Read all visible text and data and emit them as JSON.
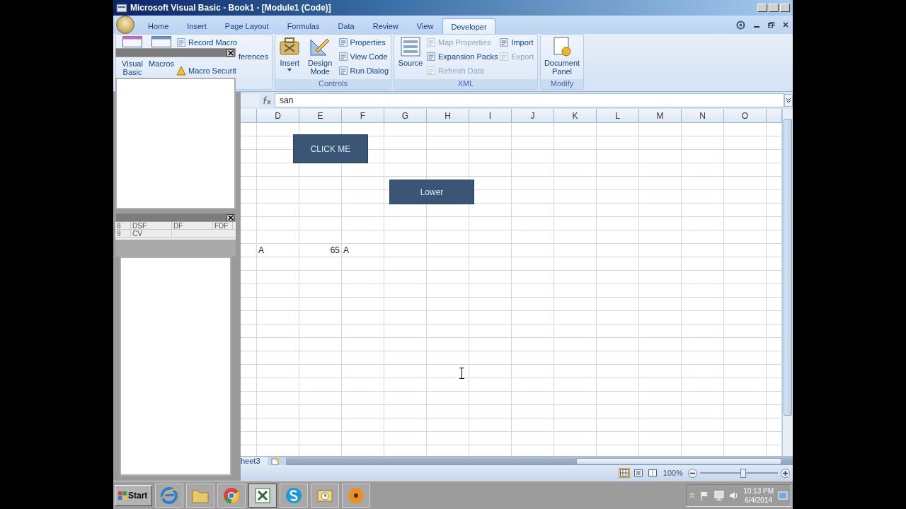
{
  "window": {
    "title": "Microsoft Visual Basic - Book1 - [Module1 (Code)]"
  },
  "tabs": [
    {
      "label": "Home",
      "selected": false
    },
    {
      "label": "Insert",
      "selected": false
    },
    {
      "label": "Page Layout",
      "selected": false
    },
    {
      "label": "Formulas",
      "selected": false
    },
    {
      "label": "Data",
      "selected": false
    },
    {
      "label": "Review",
      "selected": false
    },
    {
      "label": "View",
      "selected": false
    },
    {
      "label": "Developer",
      "selected": true
    }
  ],
  "code_group": {
    "large_buttons": [
      "Visual Basic",
      "Macros"
    ],
    "small_buttons": [
      {
        "label": "Record Macro",
        "kind": "full"
      },
      {
        "label": "ferences",
        "kind": "covered"
      },
      {
        "label": "Macro Securit",
        "kind": "full"
      }
    ]
  },
  "groups": [
    {
      "label": "Controls",
      "items": [
        {
          "label": "Insert",
          "kind": "large",
          "dropdown": true,
          "disabled": false
        },
        {
          "label": "Design Mode",
          "kind": "large",
          "dropdown": false,
          "disabled": false
        },
        {
          "label": "Properties",
          "kind": "small",
          "dropdown": false,
          "disabled": false
        },
        {
          "label": "View Code",
          "kind": "small",
          "dropdown": false,
          "disabled": false
        },
        {
          "label": "Run Dialog",
          "kind": "small",
          "dropdown": false,
          "disabled": false
        }
      ]
    },
    {
      "label": "XML",
      "items": [
        {
          "label": "Source",
          "kind": "large",
          "dropdown": false,
          "disabled": false
        },
        {
          "label": "Map Properties",
          "kind": "small",
          "dropdown": false,
          "disabled": true
        },
        {
          "label": "Expansion Packs",
          "kind": "small",
          "dropdown": false,
          "disabled": false
        },
        {
          "label": "Refresh Data",
          "kind": "small",
          "dropdown": false,
          "disabled": true
        },
        {
          "label": "Import",
          "kind": "small",
          "dropdown": false,
          "disabled": false
        },
        {
          "label": "Export",
          "kind": "small",
          "dropdown": false,
          "disabled": true
        }
      ]
    },
    {
      "label": "Modify",
      "items": [
        {
          "label": "Document Panel",
          "kind": "large",
          "dropdown": false,
          "disabled": false
        }
      ]
    }
  ],
  "formula_bar": {
    "value": "san"
  },
  "columns": [
    "D",
    "E",
    "F",
    "G",
    "H",
    "I",
    "J",
    "K",
    "L",
    "M",
    "N",
    "O"
  ],
  "rows": [
    {
      "kind": "blank"
    },
    {
      "kind": "blank"
    },
    {
      "kind": "blank"
    },
    {
      "kind": "blank"
    },
    {
      "kind": "blank"
    },
    {
      "kind": "blank"
    },
    {
      "kind": "blank"
    },
    {
      "kind": "blank"
    },
    {
      "kind": "blank"
    },
    {
      "kind": "data",
      "cells": [
        {
          "value": "A",
          "kind": "text"
        },
        {
          "value": "65",
          "kind": "number"
        },
        {
          "value": "A",
          "kind": "text"
        }
      ]
    },
    {
      "kind": "blank"
    },
    {
      "kind": "blank"
    },
    {
      "kind": "blank"
    },
    {
      "kind": "blank"
    },
    {
      "kind": "blank"
    },
    {
      "kind": "blank"
    },
    {
      "kind": "blank"
    },
    {
      "kind": "blank"
    },
    {
      "kind": "blank"
    },
    {
      "kind": "blank"
    },
    {
      "kind": "blank"
    },
    {
      "kind": "blank"
    },
    {
      "kind": "blank"
    },
    {
      "kind": "blank"
    },
    {
      "kind": "blank"
    }
  ],
  "shapes": [
    {
      "label": "CLICK ME"
    },
    {
      "label": "Lower"
    }
  ],
  "sheet_tabs": [
    {
      "label": "heet3"
    }
  ],
  "views": [
    {
      "selected": true
    },
    {
      "selected": false
    },
    {
      "selected": false
    }
  ],
  "zoom": {
    "reading": "100%",
    "level": 0.55
  },
  "vba": {
    "ghost_rows": [
      [
        "8",
        "DSF",
        "DF",
        "FDF"
      ],
      [
        "9",
        "CV"
      ]
    ]
  },
  "taskbar": {
    "start": "Start",
    "apps": [
      {
        "selected": false
      },
      {
        "selected": false
      },
      {
        "selected": false
      },
      {
        "selected": true
      },
      {
        "selected": false
      },
      {
        "selected": false
      },
      {
        "selected": false
      }
    ],
    "time": "10:13 PM",
    "date": "6/4/2014"
  }
}
